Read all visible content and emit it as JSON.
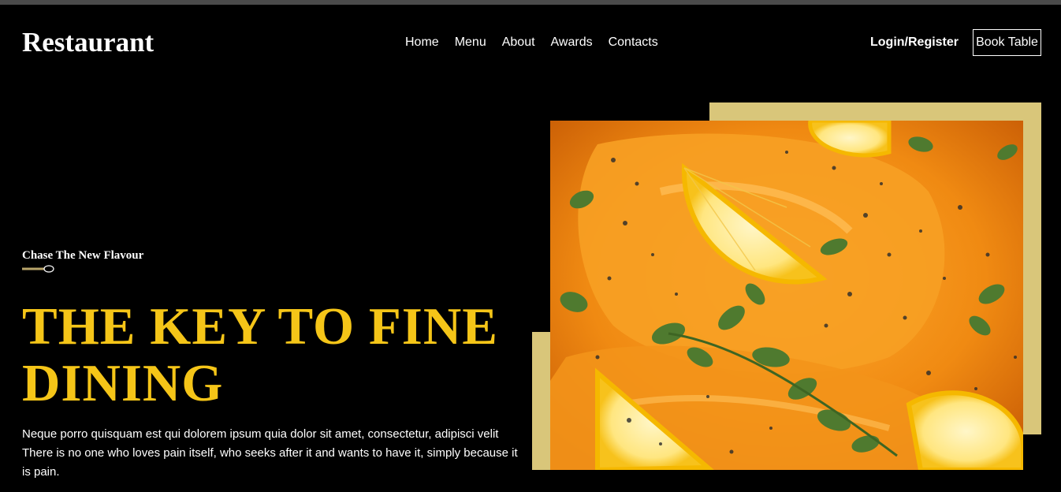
{
  "brand": {
    "logo": "Restaurant"
  },
  "nav": {
    "items": [
      "Home",
      "Menu",
      "About",
      "Awards",
      "Contacts"
    ]
  },
  "header": {
    "login_label": "Login/Register",
    "book_label": "Book Table"
  },
  "hero": {
    "tagline": "Chase The New Flavour",
    "headline_line1": "THE KEY TO FINE",
    "headline_line2": "DINING",
    "description": "Neque porro quisquam est qui dolorem ipsum quia dolor sit amet, consectetur, adipisci velit There is no one who loves pain itself, who seeks after it and wants to have it, simply because it is pain."
  },
  "colors": {
    "accent": "#f5c518",
    "frame": "#d9c67a",
    "background": "#000000"
  }
}
